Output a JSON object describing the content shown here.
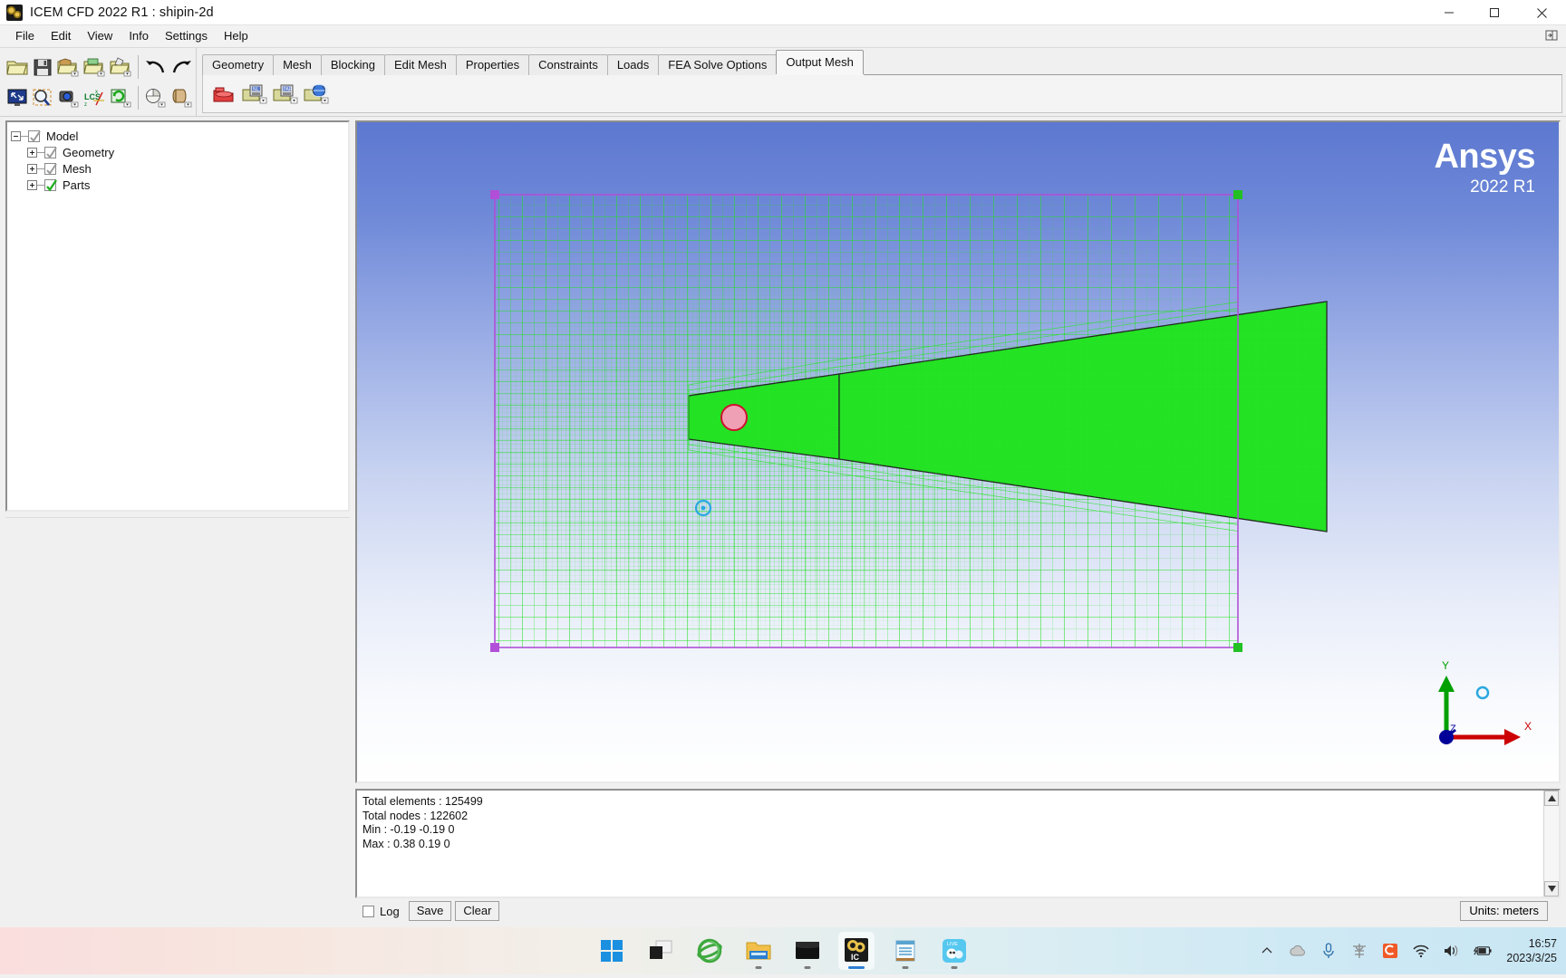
{
  "window": {
    "title": "ICEM CFD 2022 R1 : shipin-2d",
    "app_icon": "ansys-icem-icon",
    "minimize": "minimize-icon",
    "maximize": "maximize-icon",
    "close": "close-icon"
  },
  "menu": {
    "items": [
      "File",
      "Edit",
      "View",
      "Info",
      "Settings",
      "Help"
    ]
  },
  "toolbar": {
    "row1": [
      {
        "name": "open-project-icon",
        "tip": "Open Project"
      },
      {
        "name": "save-project-icon",
        "tip": "Save Project"
      },
      {
        "name": "open-geometry-icon",
        "tip": "Open Geometry"
      },
      {
        "name": "open-mesh-icon",
        "tip": "Open Mesh"
      },
      {
        "name": "open-blocking-icon",
        "tip": "Open Blocking"
      },
      {
        "name": "undo-icon",
        "tip": "Undo"
      },
      {
        "name": "redo-icon",
        "tip": "Redo"
      }
    ],
    "row2": [
      {
        "name": "fit-window-icon",
        "tip": "Fit Window"
      },
      {
        "name": "zoom-box-icon",
        "tip": "Zoom Box"
      },
      {
        "name": "save-view-icon",
        "tip": "Save Picture"
      },
      {
        "name": "lcs-icon",
        "tip": "Local Coordinate System"
      },
      {
        "name": "refresh-icon",
        "tip": "Refresh"
      },
      {
        "name": "display-mode-icon",
        "tip": "Display Mode"
      },
      {
        "name": "solid-simple-icon",
        "tip": "Solid Simple Display"
      }
    ]
  },
  "tabs": {
    "items": [
      "Geometry",
      "Mesh",
      "Blocking",
      "Edit Mesh",
      "Properties",
      "Constraints",
      "Loads",
      "FEA Solve Options",
      "Output Mesh"
    ],
    "active": "Output Mesh"
  },
  "tab_toolbar": {
    "buttons": [
      {
        "name": "select-solver-icon",
        "tip": "Select Solver"
      },
      {
        "name": "boundary-conditions-icon",
        "tip": "Boundary Conditions"
      },
      {
        "name": "edit-parameters-icon",
        "tip": "Edit Parameters"
      },
      {
        "name": "write-input-icon",
        "tip": "Write input"
      }
    ]
  },
  "tree": {
    "nodes": [
      {
        "label": "Model",
        "depth": 0,
        "expander": "minus",
        "checked": "partial"
      },
      {
        "label": "Geometry",
        "depth": 1,
        "expander": "plus",
        "checked": "partial"
      },
      {
        "label": "Mesh",
        "depth": 1,
        "expander": "plus",
        "checked": "partial"
      },
      {
        "label": "Parts",
        "depth": 1,
        "expander": "plus",
        "checked": "checked"
      }
    ]
  },
  "viewport": {
    "logo_name": "Ansys",
    "logo_version": "2022 R1",
    "triad": {
      "x_label": "X",
      "y_label": "Y",
      "z_label": "Z"
    },
    "colors": {
      "mesh": "#22e022",
      "domain_border": "#b14fd8",
      "geometry_line": "#1a1a1a",
      "circle_fill": "#f0a0b4",
      "circle_edge": "#d01030",
      "origin_marker": "#2aa8e0",
      "axis_x": "#cc0000",
      "axis_y": "#00a000",
      "axis_z": "#000099"
    }
  },
  "messages": {
    "lines": [
      "Total elements : 125499",
      "Total nodes : 122602",
      "Min : -0.19 -0.19 0",
      "Max : 0.38 0.19 0"
    ],
    "text": "Total elements : 125499\nTotal nodes : 122602\nMin : -0.19 -0.19 0\nMax : 0.38 0.19 0"
  },
  "message_bar": {
    "log_label": "Log",
    "log_checked": false,
    "save_label": "Save",
    "clear_label": "Clear",
    "units_label": "Units: meters"
  },
  "taskbar": {
    "icons": [
      {
        "name": "windows-start-icon",
        "active": false,
        "dot": "none"
      },
      {
        "name": "task-view-icon",
        "active": false,
        "dot": "none"
      },
      {
        "name": "internet-explorer-icon",
        "active": false,
        "dot": "none"
      },
      {
        "name": "file-explorer-icon",
        "active": false,
        "dot": "small"
      },
      {
        "name": "terminal-icon",
        "active": false,
        "dot": "small"
      },
      {
        "name": "icem-cfd-icon",
        "active": true,
        "dot": "wide"
      },
      {
        "name": "notepad-icon",
        "active": false,
        "dot": "small"
      },
      {
        "name": "live-app-icon",
        "active": false,
        "dot": "small"
      }
    ],
    "tray": [
      {
        "name": "show-hidden-icons-icon"
      },
      {
        "name": "onedrive-cloud-icon"
      },
      {
        "name": "microphone-icon"
      },
      {
        "name": "ime-chinese-icon"
      },
      {
        "name": "sogou-input-icon"
      },
      {
        "name": "wifi-icon"
      },
      {
        "name": "volume-icon"
      },
      {
        "name": "battery-charging-icon"
      }
    ],
    "time": "16:57",
    "date": "2023/3/25"
  }
}
